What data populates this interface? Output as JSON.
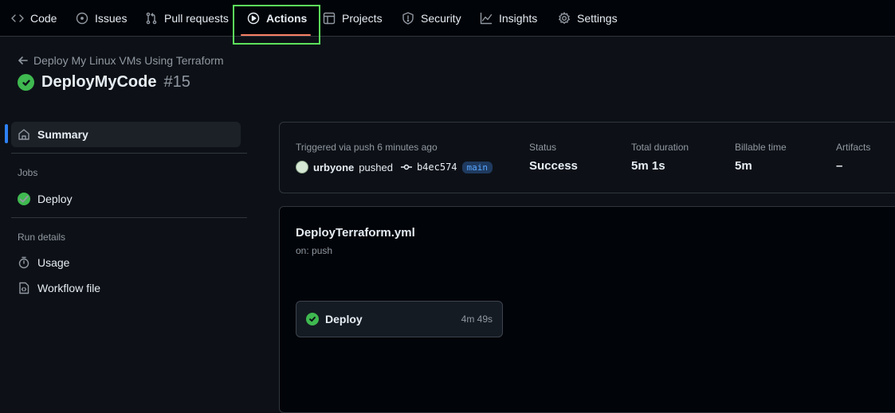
{
  "nav": {
    "tabs": [
      {
        "label": "Code",
        "icon": "code-icon"
      },
      {
        "label": "Issues",
        "icon": "issue-icon"
      },
      {
        "label": "Pull requests",
        "icon": "pull-request-icon"
      },
      {
        "label": "Actions",
        "icon": "play-icon",
        "active": true
      },
      {
        "label": "Projects",
        "icon": "table-icon"
      },
      {
        "label": "Security",
        "icon": "shield-icon"
      },
      {
        "label": "Insights",
        "icon": "graph-icon"
      },
      {
        "label": "Settings",
        "icon": "gear-icon"
      }
    ],
    "active_color": "#f78166",
    "highlight_color": "#5ce25c"
  },
  "header": {
    "back_label": "Deploy My Linux VMs Using Terraform",
    "run_name": "DeployMyCode",
    "run_number": "#15",
    "status_color": "#3fb950"
  },
  "sidebar": {
    "summary_label": "Summary",
    "jobs_heading": "Jobs",
    "jobs": [
      {
        "label": "Deploy"
      }
    ],
    "run_details_heading": "Run details",
    "run_details": [
      {
        "label": "Usage"
      },
      {
        "label": "Workflow file"
      }
    ]
  },
  "summary": {
    "trigger_text": "Triggered via push 6 minutes ago",
    "actor": "urbyone",
    "action": "pushed",
    "commit": "b4ec574",
    "branch": "main",
    "status_label": "Status",
    "status_value": "Success",
    "duration_label": "Total duration",
    "duration_value": "5m 1s",
    "billable_label": "Billable time",
    "billable_value": "5m",
    "artifacts_label": "Artifacts",
    "artifacts_value": "–"
  },
  "workflow": {
    "file_name": "DeployTerraform.yml",
    "trigger": "on: push",
    "jobs": [
      {
        "name": "Deploy",
        "duration": "4m 49s"
      }
    ]
  }
}
